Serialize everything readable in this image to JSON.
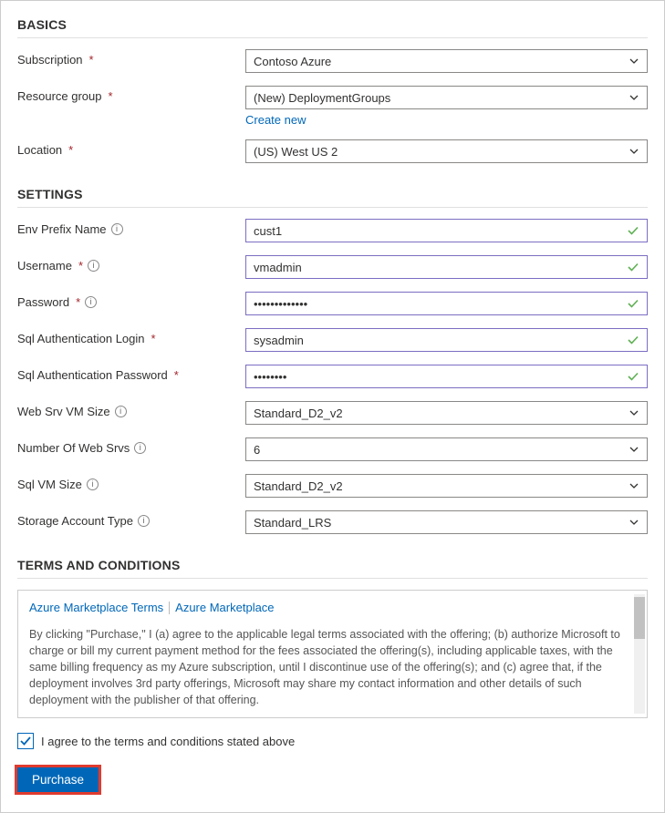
{
  "sections": {
    "basics": "BASICS",
    "settings": "SETTINGS",
    "terms": "TERMS AND CONDITIONS"
  },
  "basics": {
    "subscription": {
      "label": "Subscription",
      "value": "Contoso Azure"
    },
    "resourceGroup": {
      "label": "Resource group",
      "value": "(New) DeploymentGroups",
      "createNew": "Create new"
    },
    "location": {
      "label": "Location",
      "value": "(US) West US 2"
    }
  },
  "settings": {
    "envPrefix": {
      "label": "Env Prefix Name",
      "value": "cust1"
    },
    "username": {
      "label": "Username",
      "value": "vmadmin"
    },
    "password": {
      "label": "Password",
      "value": "•••••••••••••"
    },
    "sqlLogin": {
      "label": "Sql Authentication Login",
      "value": "sysadmin"
    },
    "sqlPassword": {
      "label": "Sql Authentication Password",
      "value": "••••••••"
    },
    "webSrvVmSize": {
      "label": "Web Srv VM Size",
      "value": "Standard_D2_v2"
    },
    "webSrvCount": {
      "label": "Number Of Web Srvs",
      "value": "6"
    },
    "sqlVmSize": {
      "label": "Sql VM Size",
      "value": "Standard_D2_v2"
    },
    "storageType": {
      "label": "Storage Account Type",
      "value": "Standard_LRS"
    }
  },
  "terms": {
    "tab1": "Azure Marketplace Terms",
    "tab2": "Azure Marketplace",
    "body": "By clicking \"Purchase,\" I (a) agree to the applicable legal terms associated with the offering; (b) authorize Microsoft to charge or bill my current payment method for the fees associated the offering(s), including applicable taxes, with the same billing frequency as my Azure subscription, until I discontinue use of the offering(s); and (c) agree that, if the deployment involves 3rd party offerings, Microsoft may share my contact information and other details of such deployment with the publisher of that offering.",
    "agree": "I agree to the terms and conditions stated above"
  },
  "buttons": {
    "purchase": "Purchase"
  }
}
